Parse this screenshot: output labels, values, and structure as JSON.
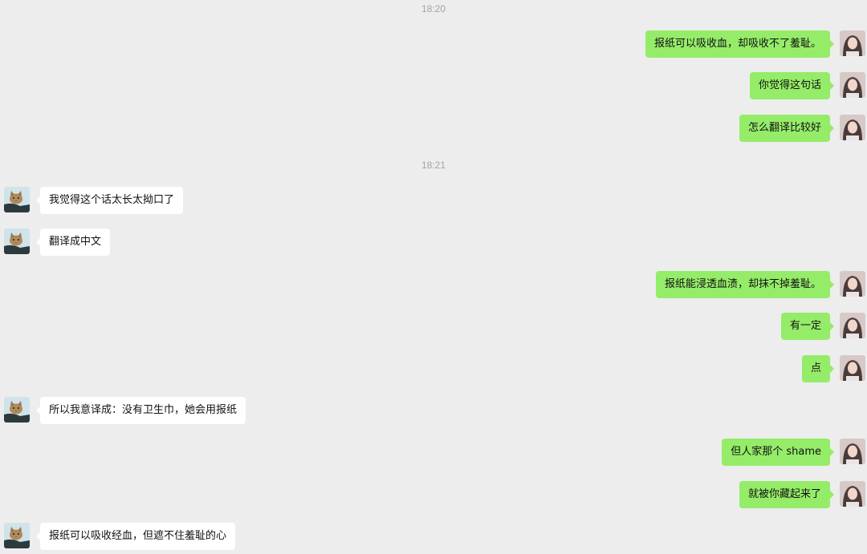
{
  "colors": {
    "background": "#ededed",
    "self_bubble": "#95ec69",
    "other_bubble": "#ffffff",
    "timestamp": "#a3a3a3"
  },
  "timestamps": [
    "18:20",
    "18:21"
  ],
  "participants": {
    "self": {
      "avatar_icon": "girl-photo-avatar"
    },
    "other": {
      "avatar_icon": "cat-photo-avatar"
    }
  },
  "messages": [
    {
      "sender": "self",
      "text": "报纸可以吸收血，却吸收不了羞耻。"
    },
    {
      "sender": "self",
      "text": "你觉得这句话"
    },
    {
      "sender": "self",
      "text": "怎么翻译比较好"
    },
    {
      "sender": "other",
      "text": "我觉得这个话太长太拗口了"
    },
    {
      "sender": "other",
      "text": "翻译成中文"
    },
    {
      "sender": "self",
      "text": "报纸能浸透血渍，却抹不掉羞耻。"
    },
    {
      "sender": "self",
      "text": "有一定"
    },
    {
      "sender": "self",
      "text": "点"
    },
    {
      "sender": "other",
      "text": "所以我意译成：没有卫生巾，她会用报纸"
    },
    {
      "sender": "self",
      "text": "但人家那个 shame"
    },
    {
      "sender": "self",
      "text": "就被你藏起来了"
    },
    {
      "sender": "other",
      "text": "报纸可以吸收经血，但遮不住羞耻的心"
    }
  ]
}
